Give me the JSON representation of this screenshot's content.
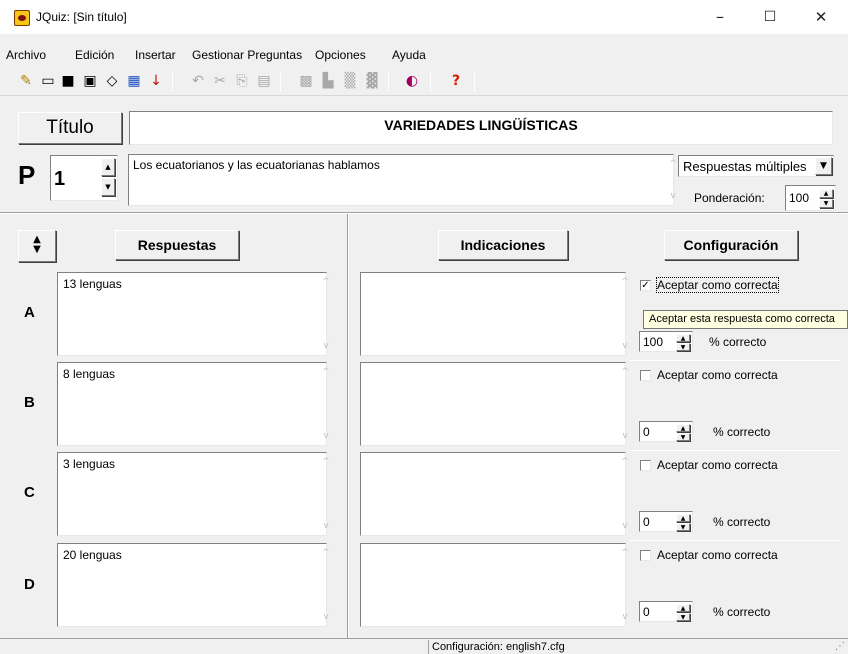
{
  "window": {
    "title": "JQuiz: [Sin título]",
    "minimize_glyph": "–",
    "maximize_glyph": "☐",
    "close_glyph": "✕"
  },
  "menu": [
    "Archivo",
    "Edición",
    "Insertar",
    "Gestionar Preguntas",
    "Opciones",
    "Ayuda"
  ],
  "toolbar": {
    "icons": [
      "new-file-icon",
      "open-folder-icon",
      "save-icon",
      "save-as-icon",
      "eraser-icon",
      "web-page-icon",
      "add-down-icon",
      "undo-icon",
      "cut-icon",
      "copy-icon",
      "paste-icon",
      "insert-picture-icon",
      "insert-media-icon",
      "insert-link-icon",
      "insert-anchor-icon",
      "config-icon",
      "help-icon"
    ]
  },
  "title_field": {
    "label": "Título",
    "value": "VARIEDADES LINGÜÍSTICAS"
  },
  "question": {
    "label": "P",
    "number": "1",
    "text": "Los ecuatorianos y las ecuatorianas hablamos",
    "type_selected": "Respuestas múltiples",
    "weight_label": "Ponderación:",
    "weight_value": "100"
  },
  "headers": {
    "answers": "Respuestas",
    "feedback": "Indicaciones",
    "settings": "Configuración"
  },
  "answers": [
    {
      "letter": "A",
      "text": "13 lenguas",
      "accept_label": "Aceptar como correcta",
      "checked": true,
      "percent": "100",
      "percent_label": "% correcto"
    },
    {
      "letter": "B",
      "text": "8 lenguas",
      "accept_label": "Aceptar como correcta",
      "checked": false,
      "percent": "0",
      "percent_label": "% correcto"
    },
    {
      "letter": "C",
      "text": "3 lenguas",
      "accept_label": "Aceptar como correcta",
      "checked": false,
      "percent": "0",
      "percent_label": "% correcto"
    },
    {
      "letter": "D",
      "text": "20 lenguas",
      "accept_label": "Aceptar como correcta",
      "checked": false,
      "percent": "0",
      "percent_label": "% correcto"
    }
  ],
  "tooltip": "Aceptar esta respuesta como correcta",
  "status": "Configuración: english7.cfg"
}
